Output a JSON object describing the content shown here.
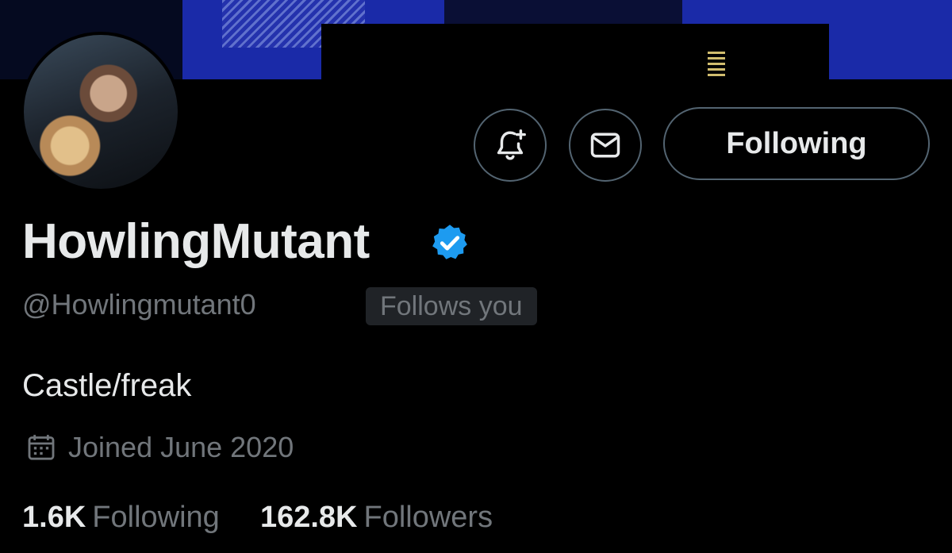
{
  "profile": {
    "display_name": "HowlingMutant",
    "handle": "@Howlingmutant0",
    "follows_you_badge": "Follows you",
    "bio": "Castle/freak",
    "joined": "Joined June 2020",
    "verified": true
  },
  "actions": {
    "notify_icon": "bell-plus-icon",
    "message_icon": "envelope-icon",
    "follow_label": "Following"
  },
  "stats": {
    "following_count": "1.6K",
    "following_label": "Following",
    "followers_count": "162.8K",
    "followers_label": "Followers"
  },
  "colors": {
    "background": "#000000",
    "text_primary": "#e7e9ea",
    "text_secondary": "#71767b",
    "border": "#536471",
    "verified_blue": "#1d9bf0",
    "badge_bg": "#202327"
  }
}
